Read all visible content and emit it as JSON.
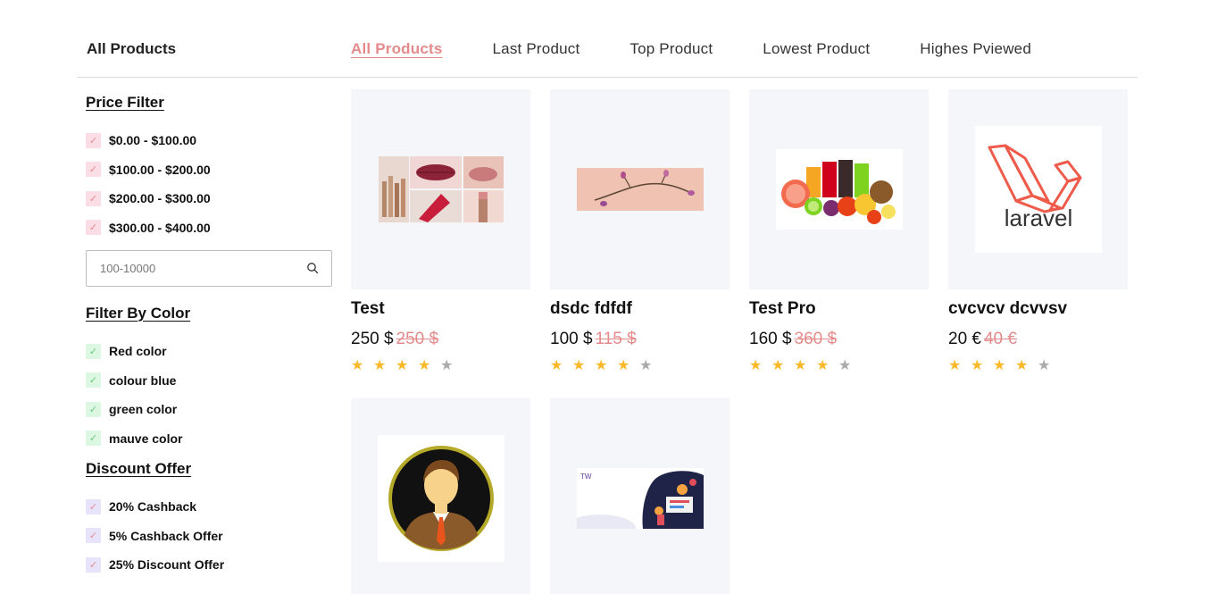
{
  "header": {
    "title": "All Products",
    "tabs": [
      {
        "label": "All Products",
        "active": true
      },
      {
        "label": "Last Product",
        "active": false
      },
      {
        "label": "Top Product",
        "active": false
      },
      {
        "label": "Lowest Product",
        "active": false
      },
      {
        "label": "Highes Pviewed",
        "active": false
      }
    ]
  },
  "sidebar": {
    "price_filter": {
      "title": "Price Filter",
      "options": [
        "$0.00 - $100.00",
        "$100.00 - $200.00",
        "$200.00 - $300.00",
        "$300.00 - $400.00"
      ],
      "search_placeholder": "100-10000"
    },
    "color_filter": {
      "title": "Filter By Color",
      "options": [
        "Red color",
        "colour blue",
        "green color",
        "mauve color"
      ]
    },
    "discount_filter": {
      "title": "Discount Offer",
      "options": [
        "20% Cashback",
        "5% Cashback Offer",
        "25% Discount Offer"
      ]
    }
  },
  "products": [
    {
      "name": "Test",
      "price": "250 $",
      "old_price": "250 $",
      "rating": 4,
      "image": "lipstick-collage"
    },
    {
      "name": "dsdc fdfdf",
      "price": "100 $",
      "old_price": "115 $",
      "rating": 4,
      "image": "flower-branch"
    },
    {
      "name": "Test Pro",
      "price": "160 $",
      "old_price": "360 $",
      "rating": 4,
      "image": "fruits-juice"
    },
    {
      "name": "cvcvcv dcvvsv",
      "price": "20 €",
      "old_price": "40 €",
      "rating": 4,
      "image": "laravel-logo"
    },
    {
      "name": "",
      "price": "",
      "old_price": "",
      "rating": 0,
      "image": "businessman-avatar"
    },
    {
      "name": "",
      "price": "",
      "old_price": "",
      "rating": 0,
      "image": "web-dev-illustration"
    }
  ],
  "laravel_logo_text": "laravel",
  "colors": {
    "accent": "#e58a8a",
    "star": "#fbb829",
    "card_bg": "#f5f6fa"
  }
}
